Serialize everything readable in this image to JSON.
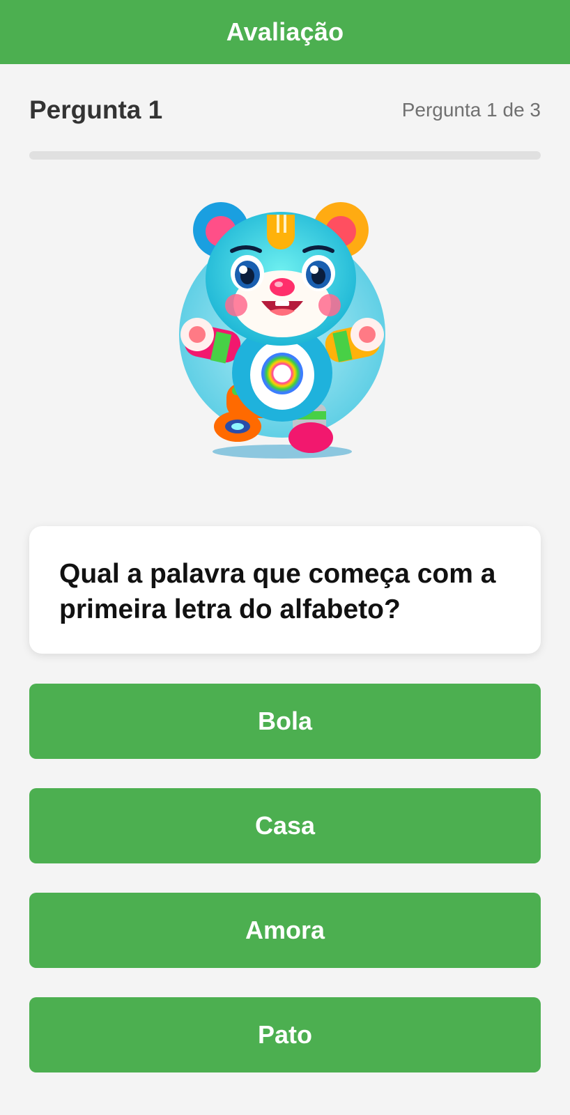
{
  "app_bar": {
    "title": "Avaliação"
  },
  "question": {
    "heading": "Pergunta 1",
    "counter": "Pergunta 1 de 3",
    "progress": 0,
    "mascot_icon": "bear-mascot-illustration",
    "text": "Qual a palavra que começa com a primeira letra do alfabeto?"
  },
  "answers": [
    {
      "label": "Bola"
    },
    {
      "label": "Casa"
    },
    {
      "label": "Amora"
    },
    {
      "label": "Pato"
    }
  ],
  "colors": {
    "primary": "#4caf50",
    "background": "#f4f4f4",
    "card": "#ffffff",
    "progress_track": "#e0e0e0"
  }
}
